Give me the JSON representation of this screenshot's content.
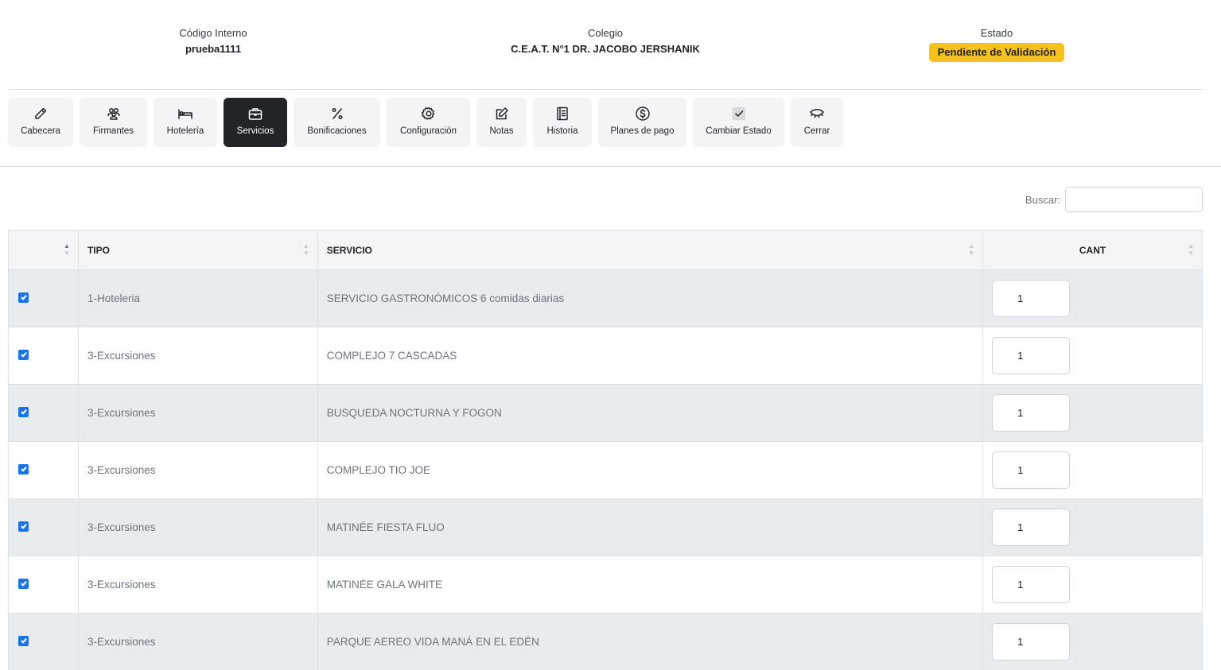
{
  "header": {
    "codigo_label": "Código Interno",
    "codigo_value": "prueba1111",
    "colegio_label": "Colegio",
    "colegio_value": "C.E.A.T. N°1 DR. JACOBO JERSHANIK",
    "estado_label": "Estado",
    "estado_value": "Pendiente de Validación",
    "estado_color": "#f5c21b"
  },
  "toolbar": {
    "active": "Servicios",
    "buttons": [
      {
        "label": "Cabecera",
        "icon": "pencil-icon"
      },
      {
        "label": "Firmantes",
        "icon": "people-icon"
      },
      {
        "label": "Hotelería",
        "icon": "bed-icon"
      },
      {
        "label": "Servicios",
        "icon": "briefcase-icon"
      },
      {
        "label": "Bonificaciones",
        "icon": "percent-icon"
      },
      {
        "label": "Configuración",
        "icon": "gear-icon"
      },
      {
        "label": "Notas",
        "icon": "edit-note-icon"
      },
      {
        "label": "Historia",
        "icon": "journal-icon"
      },
      {
        "label": "Planes de pago",
        "icon": "dollar-coin-icon"
      },
      {
        "label": "Cambiar Estado",
        "icon": "check-square-icon"
      },
      {
        "label": "Cerrar",
        "icon": "eye-closed-icon"
      }
    ]
  },
  "search": {
    "label": "Buscar:",
    "value": ""
  },
  "table": {
    "columns": [
      "",
      "TIPO",
      "SERVICIO",
      "CANT"
    ],
    "rows": [
      {
        "checked": true,
        "tipo": "1-Hoteleria",
        "servicio": "SERVICIO GASTRONÓMICOS 6 comidas diarias",
        "cant": "1"
      },
      {
        "checked": true,
        "tipo": "3-Excursiones",
        "servicio": "COMPLEJO 7 CASCADAS",
        "cant": "1"
      },
      {
        "checked": true,
        "tipo": "3-Excursiones",
        "servicio": "BUSQUEDA NOCTURNA Y FOGON",
        "cant": "1"
      },
      {
        "checked": true,
        "tipo": "3-Excursiones",
        "servicio": "COMPLEJO TIO JOE",
        "cant": "1"
      },
      {
        "checked": true,
        "tipo": "3-Excursiones",
        "servicio": "MATINÉE FIESTA FLUO",
        "cant": "1"
      },
      {
        "checked": true,
        "tipo": "3-Excursiones",
        "servicio": "MATINÉE GALA WHITE",
        "cant": "1"
      },
      {
        "checked": true,
        "tipo": "3-Excursiones",
        "servicio": "PARQUE AEREO VIDA MANÁ EN EL EDÉN",
        "cant": "1"
      }
    ],
    "accent_color": "#1a73e8"
  }
}
